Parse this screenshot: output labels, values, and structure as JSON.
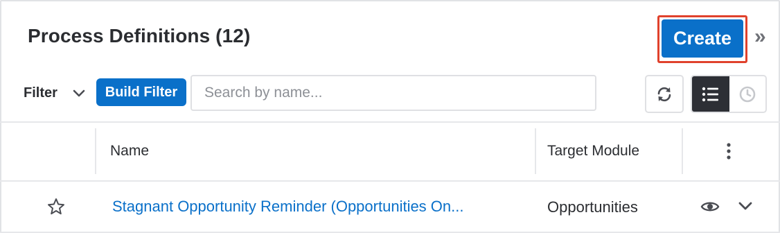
{
  "header": {
    "title": "Process Definitions (12)",
    "create_label": "Create",
    "collapse_glyph": "»"
  },
  "toolbar": {
    "filter_label": "Filter",
    "build_filter_label": "Build Filter",
    "search_placeholder": "Search by name...",
    "search_value": "",
    "icons": [
      "chevron-down-icon",
      "refresh-icon",
      "list-view-icon",
      "activity-stream-icon"
    ]
  },
  "table": {
    "columns": [
      "Name",
      "Target Module"
    ],
    "rows": [
      {
        "name": "Stagnant Opportunity Reminder (Opportunities On...",
        "target_module": "Opportunities",
        "favorite": false
      }
    ]
  },
  "colors": {
    "primary": "#0a70c9",
    "highlight": "#e0412c",
    "dark": "#2d2f35",
    "border": "#dfe0e3",
    "text": "#2b2d31",
    "icon_gray": "#6f7177"
  }
}
